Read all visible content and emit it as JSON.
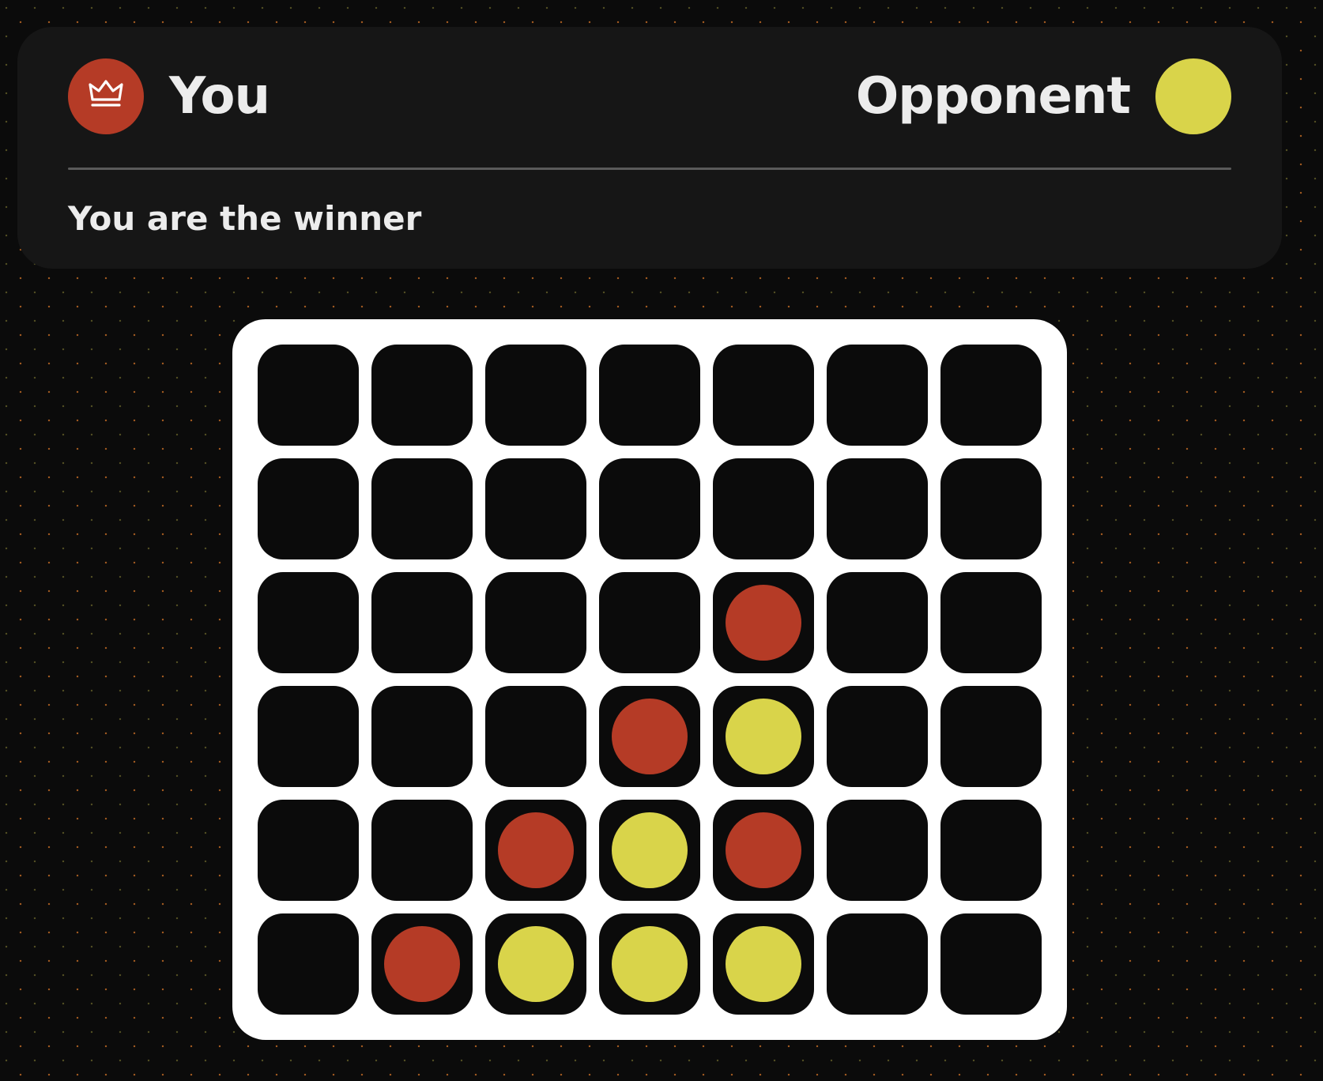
{
  "colors": {
    "red": "#b53b26",
    "yellow": "#d9d44a",
    "board": "#ffffff",
    "cell": "#0b0b0b",
    "panel": "#161616",
    "text": "#ececec"
  },
  "header": {
    "player": {
      "name": "You",
      "color": "red",
      "icon": "crown-icon"
    },
    "opponent": {
      "name": "Opponent",
      "color": "yellow"
    },
    "status": "You are the winner"
  },
  "board": {
    "columns": 7,
    "rows": 6,
    "grid": [
      [
        "",
        "",
        "",
        "",
        "",
        "",
        ""
      ],
      [
        "",
        "",
        "",
        "",
        "",
        "",
        ""
      ],
      [
        "",
        "",
        "",
        "",
        "red",
        "",
        ""
      ],
      [
        "",
        "",
        "",
        "red",
        "yellow",
        "",
        ""
      ],
      [
        "",
        "",
        "red",
        "yellow",
        "red",
        "",
        ""
      ],
      [
        "",
        "red",
        "yellow",
        "yellow",
        "yellow",
        "",
        ""
      ]
    ]
  }
}
